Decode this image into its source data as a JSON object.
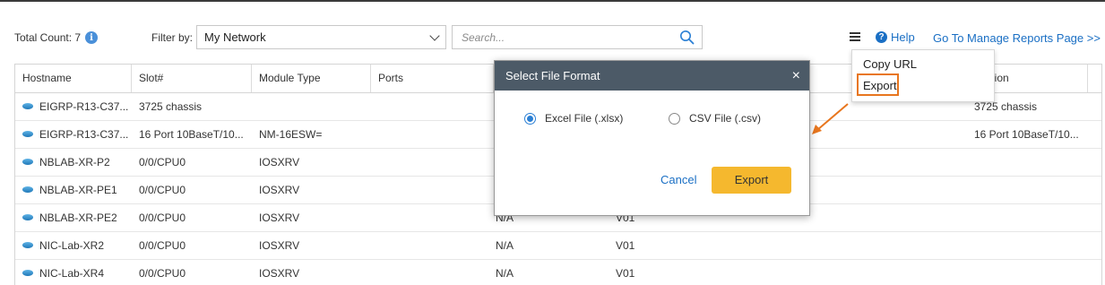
{
  "toolbar": {
    "total_label": "Total Count: 7",
    "filter_label": "Filter by:",
    "filter_value": "My Network",
    "search_placeholder": "Search...",
    "help_label": "Help",
    "goto_label": "Go To Manage Reports Page >>"
  },
  "icons": {
    "info": "info-icon",
    "help": "help-icon",
    "search": "search-icon",
    "menu": "menu-icon",
    "device": "router-icon"
  },
  "table": {
    "columns": [
      "Hostname",
      "Slot#",
      "Module Type",
      "Ports",
      "",
      "",
      "Description"
    ],
    "columns_visible": {
      "hostname": "Hostname",
      "slot": "Slot#",
      "module_type": "Module Type",
      "ports": "Ports",
      "description": "cription"
    },
    "rows": [
      {
        "hostname": "EIGRP-R13-C37...",
        "slot": "3725 chassis",
        "module_type": "",
        "col5": "",
        "col6": "",
        "description": "3725 chassis"
      },
      {
        "hostname": "EIGRP-R13-C37...",
        "slot": "16 Port 10BaseT/10...",
        "module_type": "NM-16ESW=",
        "col5": "",
        "col6": "",
        "description": "16 Port 10BaseT/10..."
      },
      {
        "hostname": "NBLAB-XR-P2",
        "slot": "0/0/CPU0",
        "module_type": "IOSXRV",
        "col5": "",
        "col6": "",
        "description": ""
      },
      {
        "hostname": "NBLAB-XR-PE1",
        "slot": "0/0/CPU0",
        "module_type": "IOSXRV",
        "col5": "",
        "col6": "",
        "description": ""
      },
      {
        "hostname": "NBLAB-XR-PE2",
        "slot": "0/0/CPU0",
        "module_type": "IOSXRV",
        "col5": "N/A",
        "col6": "V01",
        "description": ""
      },
      {
        "hostname": "NIC-Lab-XR2",
        "slot": "0/0/CPU0",
        "module_type": "IOSXRV",
        "col5": "N/A",
        "col6": "V01",
        "description": ""
      },
      {
        "hostname": "NIC-Lab-XR4",
        "slot": "0/0/CPU0",
        "module_type": "IOSXRV",
        "col5": "N/A",
        "col6": "V01",
        "description": ""
      }
    ]
  },
  "menu": {
    "items": [
      "Copy URL",
      "Export"
    ]
  },
  "modal": {
    "title": "Select File Format",
    "close": "×",
    "option_excel": "Excel File (.xlsx)",
    "option_csv": "CSV File (.csv)",
    "selected": "excel",
    "cancel_label": "Cancel",
    "export_label": "Export"
  },
  "colors": {
    "accent": "#1a6fc4",
    "modal_header": "#4c5a67",
    "export_button": "#f5b82e",
    "highlight": "#e8761e"
  }
}
